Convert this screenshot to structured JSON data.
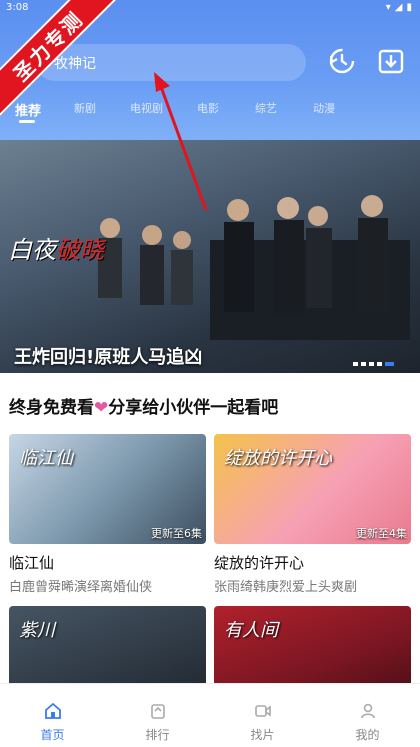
{
  "status": {
    "time": "3:08",
    "icons": [
      "wifi-icon",
      "signal-icon",
      "battery-icon"
    ]
  },
  "watermark": "圣力专测",
  "search": {
    "value": "牧神记"
  },
  "header_icons": [
    "history-icon",
    "download-icon"
  ],
  "tabs": [
    {
      "label": "推荐",
      "active": true
    },
    {
      "label": "新剧"
    },
    {
      "label": "电视剧"
    },
    {
      "label": "电影"
    },
    {
      "label": "综艺"
    },
    {
      "label": "动漫"
    }
  ],
  "banner": {
    "logo_prefix": "白夜",
    "logo_highlight": "破晓",
    "caption": "王炸回归!原班人马追凶",
    "dot_count": 5,
    "active_dot": 4
  },
  "promo": {
    "before": "终身免费看",
    "heart": "❤",
    "after": "分享给小伙伴一起看吧"
  },
  "cards": [
    {
      "thumb_title": "临江仙",
      "badge": "更新至6集",
      "title": "临江仙",
      "subtitle": "白鹿曾舜晞演绎离婚仙侠"
    },
    {
      "thumb_title": "绽放的许开心",
      "badge": "更新至4集",
      "title": "绽放的许开心",
      "subtitle": "张雨绮韩庚烈爱上头爽剧"
    },
    {
      "thumb_title": "紫川",
      "badge": "",
      "title": "",
      "subtitle": ""
    },
    {
      "thumb_title": "有人间",
      "badge": "",
      "title": "",
      "subtitle": ""
    }
  ],
  "bottom_nav": [
    {
      "label": "首页",
      "icon": "home-icon",
      "active": true
    },
    {
      "label": "排行",
      "icon": "ranking-icon"
    },
    {
      "label": "找片",
      "icon": "video-icon"
    },
    {
      "label": "我的",
      "icon": "profile-icon"
    }
  ],
  "colors": {
    "accent": "#3a7af2",
    "header": "#5b8ff0",
    "ribbon": "#e0151f",
    "heart": "#e25aa0"
  }
}
